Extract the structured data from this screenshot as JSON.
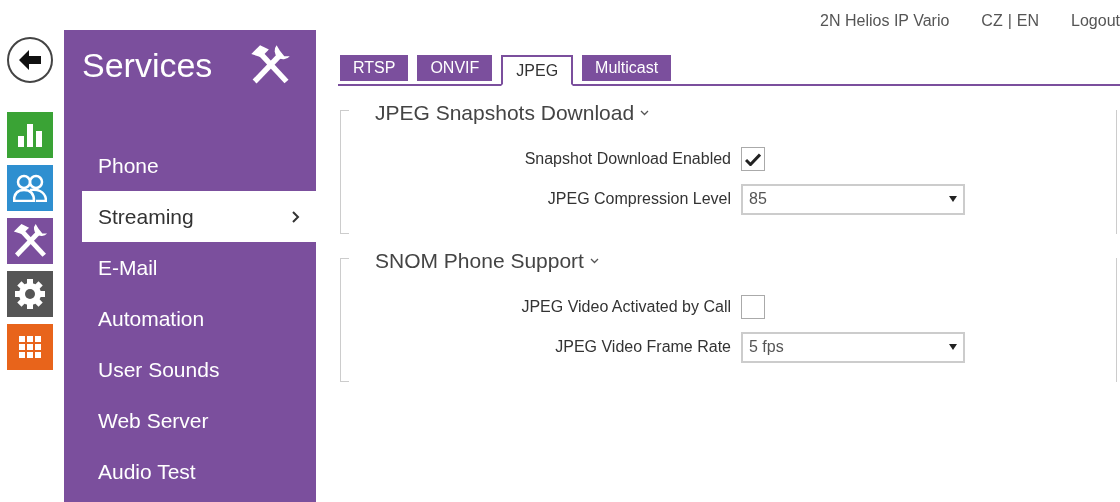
{
  "top_bar": {
    "device": "2N Helios IP Vario",
    "languages": [
      "CZ",
      "EN"
    ],
    "language_separator": "|",
    "logout": "Logout"
  },
  "nav_icons": [
    {
      "kind": "chart",
      "color": "#3aa335"
    },
    {
      "kind": "users",
      "color": "#2e8fd0"
    },
    {
      "kind": "tools",
      "color": "#7b4f9d"
    },
    {
      "kind": "gear",
      "color": "#555555"
    },
    {
      "kind": "grid",
      "color": "#e8641b"
    }
  ],
  "sidebar": {
    "title": "Services",
    "items": [
      {
        "label": "Phone",
        "selected": false
      },
      {
        "label": "Streaming",
        "selected": true
      },
      {
        "label": "E-Mail",
        "selected": false
      },
      {
        "label": "Automation",
        "selected": false
      },
      {
        "label": "User Sounds",
        "selected": false
      },
      {
        "label": "Web Server",
        "selected": false
      },
      {
        "label": "Audio Test",
        "selected": false
      }
    ]
  },
  "tabs": [
    {
      "label": "RTSP",
      "selected": false
    },
    {
      "label": "ONVIF",
      "selected": false
    },
    {
      "label": "JPEG",
      "selected": true
    },
    {
      "label": "Multicast",
      "selected": false
    }
  ],
  "sections": [
    {
      "title": "JPEG Snapshots Download",
      "fields": [
        {
          "kind": "checkbox",
          "label": "Snapshot Download Enabled",
          "checked": true
        },
        {
          "kind": "select",
          "label": "JPEG Compression Level",
          "value": "85"
        }
      ]
    },
    {
      "title": "SNOM Phone Support",
      "fields": [
        {
          "kind": "checkbox",
          "label": "JPEG Video Activated by Call",
          "checked": false
        },
        {
          "kind": "select",
          "label": "JPEG Video Frame Rate",
          "value": "5 fps"
        }
      ]
    }
  ]
}
